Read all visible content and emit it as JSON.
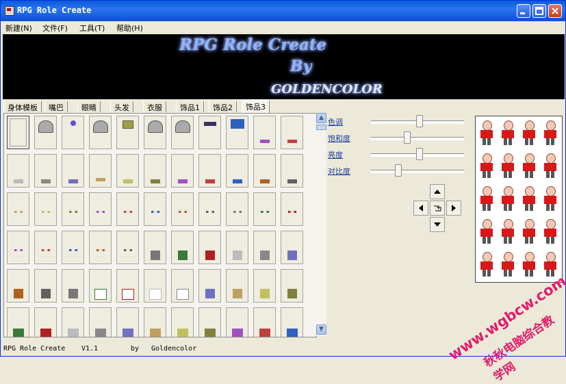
{
  "window": {
    "title": "RPG Role Create"
  },
  "menu": {
    "items": [
      "新建(N)",
      "文件(F)",
      "工具(T)",
      "帮助(H)"
    ]
  },
  "banner": {
    "line1": "RPG Role Create",
    "line2": "By",
    "line3": "GOLDENCOLOR"
  },
  "tabs": [
    {
      "label": "身体模板",
      "active": false
    },
    {
      "label": "嘴巴",
      "active": false
    },
    {
      "label": "眼睛",
      "active": false
    },
    {
      "label": "头发",
      "active": false
    },
    {
      "label": "衣服",
      "active": false
    },
    {
      "label": "饰品1",
      "active": false
    },
    {
      "label": "饰品2",
      "active": false
    },
    {
      "label": "饰品3",
      "active": true
    }
  ],
  "adjustments": [
    {
      "label": "色调",
      "value": 0.52
    },
    {
      "label": "饱和度",
      "value": 0.38
    },
    {
      "label": "亮度",
      "value": 0.52
    },
    {
      "label": "对比度",
      "value": 0.28
    }
  ],
  "status": {
    "name": "RPG Role Create",
    "version": "V1.1",
    "by": "by",
    "author": "Goldencolor"
  },
  "watermark": {
    "line1": "www.wgbcw.com",
    "line2": "秋秋电脑综合教学网"
  },
  "colors": {
    "accent": "#0a5bd8",
    "shirt": "#d81818",
    "link": "#1c3d9b",
    "watermark": "#e21c6a"
  }
}
